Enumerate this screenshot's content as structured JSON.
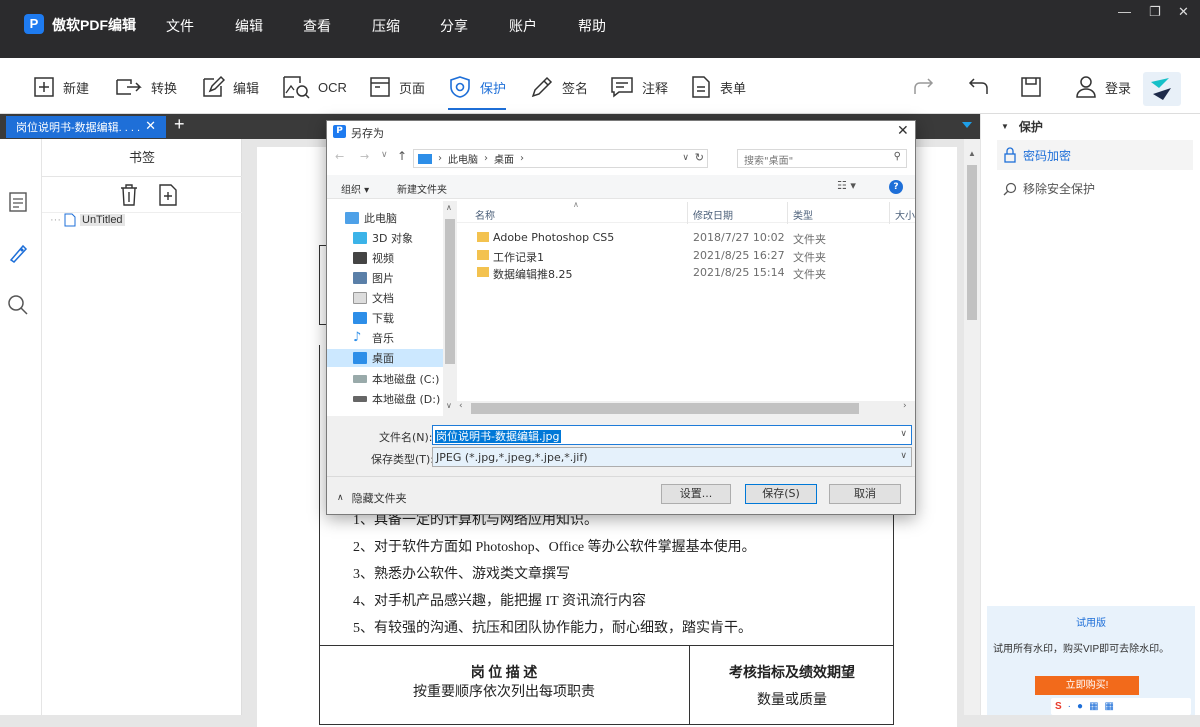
{
  "app": {
    "name": "傲软PDF编辑",
    "logo_letter": "P"
  },
  "menu": [
    "文件",
    "编辑",
    "查看",
    "压缩",
    "分享",
    "账户",
    "帮助"
  ],
  "window_controls": [
    "—",
    "❐",
    "✕"
  ],
  "toolbar": {
    "items": [
      {
        "label": "新建",
        "icon": "new-icon"
      },
      {
        "label": "转换",
        "icon": "convert-icon"
      },
      {
        "label": "编辑",
        "icon": "edit-icon"
      },
      {
        "label": "OCR",
        "icon": "ocr-icon"
      },
      {
        "label": "页面",
        "icon": "page-icon"
      },
      {
        "label": "保护",
        "icon": "shield-icon",
        "active": true
      },
      {
        "label": "签名",
        "icon": "pen-icon"
      },
      {
        "label": "注释",
        "icon": "comment-icon"
      },
      {
        "label": "表单",
        "icon": "form-icon"
      }
    ],
    "login": "登录"
  },
  "tab": {
    "title": "岗位说明书-数据编辑. . . .",
    "close": "✕",
    "add": "+"
  },
  "bookmarks": {
    "header": "书签",
    "item": "UnTitled"
  },
  "right_panel": {
    "section": "保护",
    "items": [
      "密码加密",
      "移除安全保护"
    ],
    "trial": {
      "title": "试用版",
      "text": "试用所有水印，购买VIP即可去除水印。",
      "button": "立即购买!"
    }
  },
  "document": {
    "lines": [
      "1、具备一定的计算机与网络应用知识。",
      "2、对于软件方面如 Photoshop、Office 等办公软件掌握基本使用。",
      "3、熟悉办公软件、游戏类文章撰写",
      "4、对手机产品感兴趣，能把握 IT 资讯流行内容",
      "5、有较强的沟通、抗压和团队协作能力，耐心细致，踏实肯干。"
    ],
    "table": {
      "col1_title": "岗 位 描 述",
      "col1_sub": "按重要顺序依次列出每项职责",
      "col2_title": "考核指标及绩效期望",
      "col2_sub": "数量或质量"
    }
  },
  "dialog": {
    "title": "另存为",
    "breadcrumb": [
      "此电脑",
      "桌面"
    ],
    "search_placeholder": "搜索\"桌面\"",
    "organize": "组织 ▾",
    "new_folder": "新建文件夹",
    "nav": [
      "此电脑",
      "3D 对象",
      "视频",
      "图片",
      "文档",
      "下载",
      "音乐",
      "桌面",
      "本地磁盘 (C:)",
      "本地磁盘 (D:)"
    ],
    "columns": [
      "名称",
      "修改日期",
      "类型",
      "大小"
    ],
    "files": [
      {
        "name": "Adobe Photoshop CS5",
        "date": "2018/7/27 10:02",
        "type": "文件夹"
      },
      {
        "name": "工作记录1",
        "date": "2021/8/25 16:27",
        "type": "文件夹"
      },
      {
        "name": "数据编辑推8.25",
        "date": "2021/8/25 15:14",
        "type": "文件夹"
      }
    ],
    "filename_label": "文件名(N):",
    "filename_value": "岗位说明书-数据编辑.jpg",
    "filetype_label": "保存类型(T):",
    "filetype_value": "JPEG (*.jpg,*.jpeg,*.jpe,*.jif)",
    "hide_folders": "隐藏文件夹",
    "settings": "设置...",
    "save": "保存(S)",
    "cancel": "取消"
  },
  "colors": {
    "accent": "#1e6fd8",
    "titlebar": "#2b2b2d",
    "buy": "#f26a1b"
  }
}
